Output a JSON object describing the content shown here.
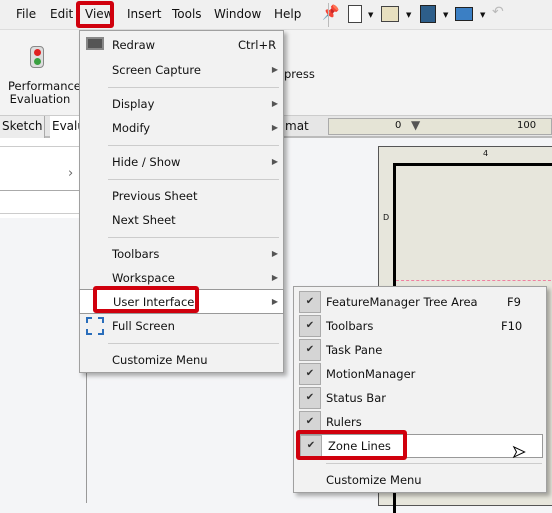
{
  "menubar": {
    "items": [
      "File",
      "Edit",
      "View",
      "Insert",
      "Tools",
      "Window",
      "Help"
    ]
  },
  "ribbon": {
    "performance_label_1": "Performance",
    "performance_label_2": "Evaluation",
    "partial_label": "press"
  },
  "tabs": [
    "Sketch",
    "Evalu",
    "mat"
  ],
  "ruler": {
    "labels": [
      "0",
      "100"
    ]
  },
  "sheet": {
    "zone_top": "4",
    "zone_left": "D"
  },
  "view_menu": {
    "redraw": "Redraw",
    "redraw_shortcut": "Ctrl+R",
    "screen_capture": "Screen Capture",
    "display": "Display",
    "modify": "Modify",
    "hide_show": "Hide / Show",
    "previous_sheet": "Previous Sheet",
    "next_sheet": "Next Sheet",
    "toolbars": "Toolbars",
    "workspace": "Workspace",
    "user_interface": "User Interface",
    "full_screen": "Full Screen",
    "customize": "Customize Menu"
  },
  "ui_submenu": {
    "items": [
      {
        "label": "FeatureManager Tree Area",
        "shortcut": "F9",
        "checked": true
      },
      {
        "label": "Toolbars",
        "shortcut": "F10",
        "checked": true
      },
      {
        "label": "Task Pane",
        "checked": true
      },
      {
        "label": "MotionManager",
        "checked": true
      },
      {
        "label": "Status Bar",
        "checked": true
      },
      {
        "label": "Rulers",
        "checked": true
      },
      {
        "label": "Zone Lines",
        "checked": true
      }
    ],
    "customize": "Customize Menu"
  },
  "colors": {
    "highlight_box": "#d0000d",
    "accent": "#2a6ebb"
  }
}
